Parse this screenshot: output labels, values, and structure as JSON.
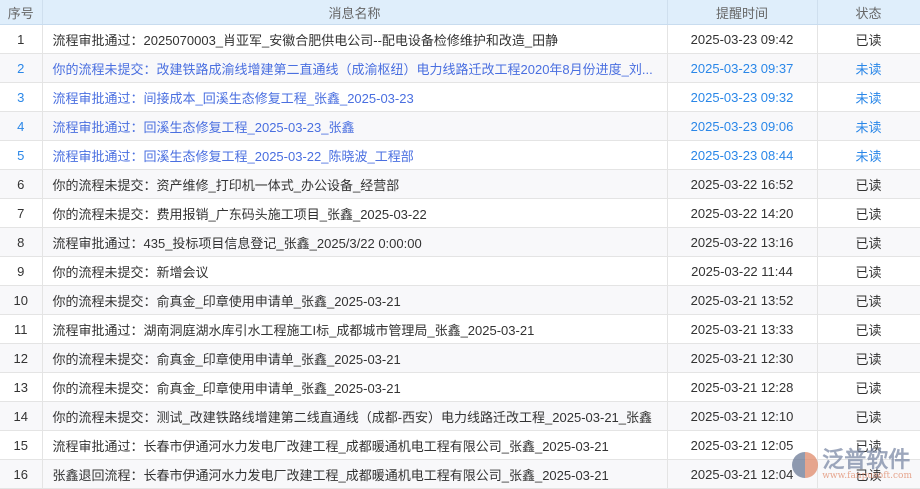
{
  "columns": [
    "序号",
    "消息名称",
    "提醒时间",
    "状态"
  ],
  "rows": [
    {
      "no": "1",
      "name": "流程审批通过：2025070003_肖亚军_安徽合肥供电公司--配电设备检修维护和改造_田静",
      "time": "2025-03-23 09:42",
      "status": "已读",
      "unread": false
    },
    {
      "no": "2",
      "name": "你的流程未提交：改建铁路成渝线增建第二直通线（成渝枢纽）电力线路迁改工程2020年8月份进度_刘...",
      "time": "2025-03-23 09:37",
      "status": "未读",
      "unread": true
    },
    {
      "no": "3",
      "name": "流程审批通过：间接成本_回溪生态修复工程_张鑫_2025-03-23",
      "time": "2025-03-23 09:32",
      "status": "未读",
      "unread": true
    },
    {
      "no": "4",
      "name": "流程审批通过：回溪生态修复工程_2025-03-23_张鑫",
      "time": "2025-03-23 09:06",
      "status": "未读",
      "unread": true
    },
    {
      "no": "5",
      "name": "流程审批通过：回溪生态修复工程_2025-03-22_陈晓波_工程部",
      "time": "2025-03-23 08:44",
      "status": "未读",
      "unread": true
    },
    {
      "no": "6",
      "name": "你的流程未提交：资产维修_打印机一体式_办公设备_经营部",
      "time": "2025-03-22 16:52",
      "status": "已读",
      "unread": false
    },
    {
      "no": "7",
      "name": "你的流程未提交：费用报销_广东码头施工项目_张鑫_2025-03-22",
      "time": "2025-03-22 14:20",
      "status": "已读",
      "unread": false
    },
    {
      "no": "8",
      "name": "流程审批通过：435_投标项目信息登记_张鑫_2025/3/22 0:00:00",
      "time": "2025-03-22 13:16",
      "status": "已读",
      "unread": false
    },
    {
      "no": "9",
      "name": "你的流程未提交：新增会议",
      "time": "2025-03-22 11:44",
      "status": "已读",
      "unread": false
    },
    {
      "no": "10",
      "name": "你的流程未提交：俞真金_印章使用申请单_张鑫_2025-03-21",
      "time": "2025-03-21 13:52",
      "status": "已读",
      "unread": false
    },
    {
      "no": "11",
      "name": "流程审批通过：湖南洞庭湖水库引水工程施工I标_成都城市管理局_张鑫_2025-03-21",
      "time": "2025-03-21 13:33",
      "status": "已读",
      "unread": false
    },
    {
      "no": "12",
      "name": "你的流程未提交：俞真金_印章使用申请单_张鑫_2025-03-21",
      "time": "2025-03-21 12:30",
      "status": "已读",
      "unread": false
    },
    {
      "no": "13",
      "name": "你的流程未提交：俞真金_印章使用申请单_张鑫_2025-03-21",
      "time": "2025-03-21 12:28",
      "status": "已读",
      "unread": false
    },
    {
      "no": "14",
      "name": "你的流程未提交：测试_改建铁路线增建第二线直通线（成都-西安）电力线路迁改工程_2025-03-21_张鑫",
      "time": "2025-03-21 12:10",
      "status": "已读",
      "unread": false
    },
    {
      "no": "15",
      "name": "流程审批通过：长春市伊通河水力发电厂改建工程_成都暖通机电工程有限公司_张鑫_2025-03-21",
      "time": "2025-03-21 12:05",
      "status": "已读",
      "unread": false
    },
    {
      "no": "16",
      "name": "张鑫退回流程：长春市伊通河水力发电厂改建工程_成都暖通机电工程有限公司_张鑫_2025-03-21",
      "time": "2025-03-21 12:04",
      "status": "已读",
      "unread": false
    }
  ],
  "watermark": {
    "brand": "泛普软件",
    "url": "www.fanpusoft.com"
  }
}
